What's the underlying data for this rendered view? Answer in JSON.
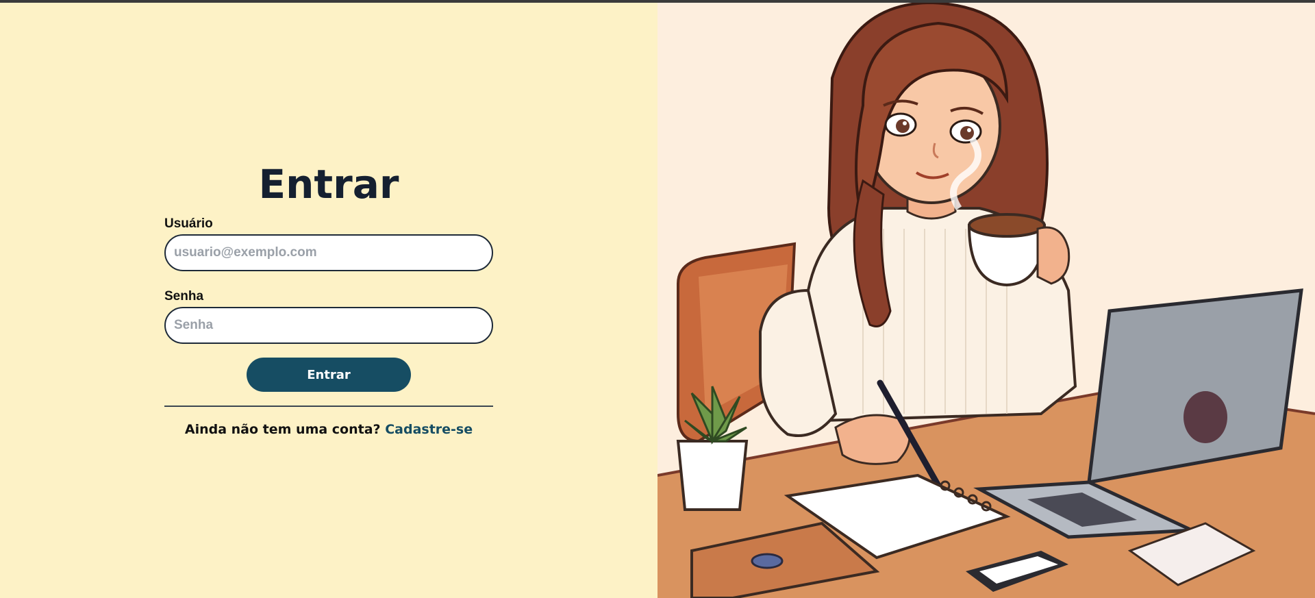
{
  "login": {
    "title": "Entrar",
    "username_label": "Usuário",
    "username_placeholder": "usuario@exemplo.com",
    "password_label": "Senha",
    "password_placeholder": "Senha",
    "submit_label": "Entrar",
    "signup_prompt": "Ainda não tem uma conta?",
    "signup_link": "Cadastre-se"
  },
  "colors": {
    "page_background": "#fdf2c6",
    "button": "#164d63",
    "link": "#164d63",
    "title": "#152030"
  },
  "illustration": {
    "icon": "woman-with-coffee-at-laptop-illustration"
  }
}
